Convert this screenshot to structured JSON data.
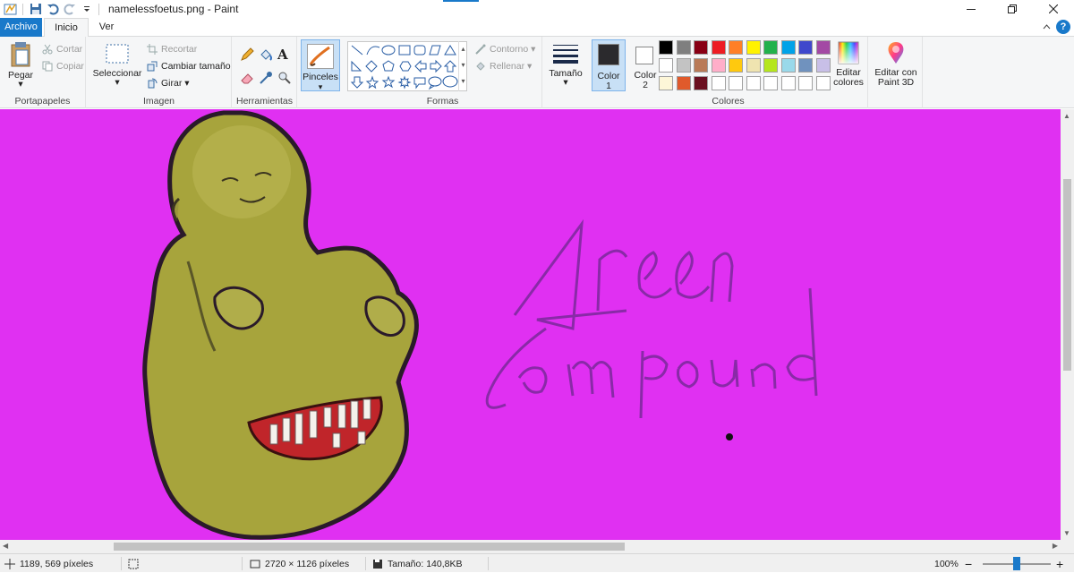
{
  "window": {
    "title": "namelessfoetus.png - Paint"
  },
  "tabs": {
    "archivo": "Archivo",
    "inicio": "Inicio",
    "ver": "Ver"
  },
  "ribbon": {
    "portapapeles": {
      "label": "Portapapeles",
      "pegar": "Pegar",
      "cortar": "Cortar",
      "copiar": "Copiar"
    },
    "imagen": {
      "label": "Imagen",
      "seleccionar": "Seleccionar",
      "recortar": "Recortar",
      "cambiar_tamano": "Cambiar tamaño",
      "girar": "Girar"
    },
    "herramientas": {
      "label": "Herramientas"
    },
    "pinceles": {
      "label": "Pinceles"
    },
    "formas": {
      "label": "Formas",
      "contorno": "Contorno",
      "rellenar": "Rellenar"
    },
    "tamano": {
      "label": "Tamaño"
    },
    "colores": {
      "label": "Colores",
      "color1_line1": "Color",
      "color1_line2": "1",
      "color2_line1": "Color",
      "color2_line2": "2",
      "editar_colores_line1": "Editar",
      "editar_colores_line2": "colores",
      "color1_value": "#2b2a2d",
      "color2_value": "#ffffff",
      "palette_row1": [
        "#000000",
        "#7f7f7f",
        "#880015",
        "#ed1c24",
        "#ff7f27",
        "#fff200",
        "#22b14c",
        "#00a2e8",
        "#3f48cc",
        "#a349a4"
      ],
      "palette_row2": [
        "#ffffff",
        "#c3c3c3",
        "#b97a57",
        "#ffaec9",
        "#ffc90e",
        "#efe4b0",
        "#b5e61d",
        "#99d9ea",
        "#7092be",
        "#c8bfe7"
      ],
      "palette_row3": [
        "#fdf6d8",
        "#e05a2b",
        "#6a1020",
        "#ffffff",
        "#ffffff",
        "#ffffff",
        "#ffffff",
        "#ffffff",
        "#ffffff",
        "#ffffff"
      ]
    },
    "paint3d": {
      "line1": "Editar con",
      "line2": "Paint 3D"
    }
  },
  "canvas": {
    "background": "#e030f2",
    "text_line1": "Green",
    "text_line2": "Compound"
  },
  "status": {
    "cursor_position": "1189, 569 píxeles",
    "image_size": "2720 × 1126 píxeles",
    "file_size": "Tamaño: 140,8KB",
    "zoom": "100%"
  }
}
